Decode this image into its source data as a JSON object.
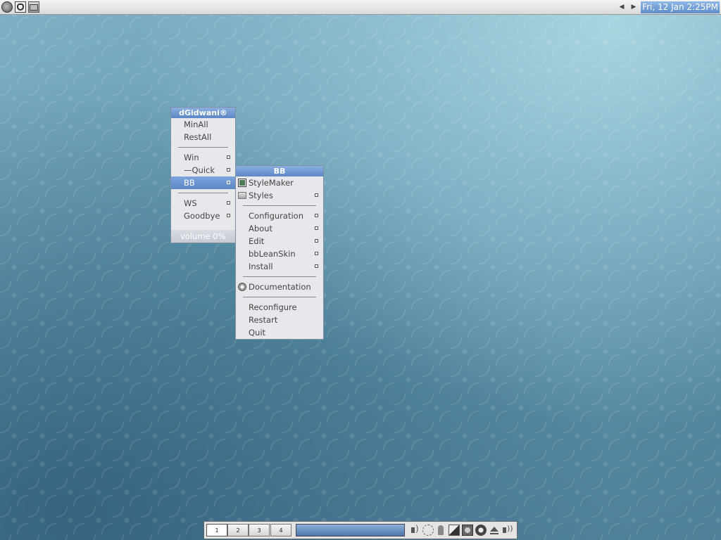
{
  "toolbar": {
    "clock": "Fri, 12 Jan 2:25PM",
    "icons": [
      "blackbox-icon",
      "style-icon",
      "folder-icon"
    ]
  },
  "main_menu": {
    "title": "dGidwani®",
    "items": [
      {
        "label": "MinAll"
      },
      {
        "label": "RestAll"
      },
      {
        "label": "Win"
      },
      {
        "label": "—Quick"
      },
      {
        "label": "BB"
      },
      {
        "label": "WS"
      },
      {
        "label": "Goodbye"
      }
    ],
    "volume": "volume 0%"
  },
  "bb_menu": {
    "title": "BB",
    "items": [
      {
        "label": "StyleMaker"
      },
      {
        "label": "Styles"
      },
      {
        "label": "Configuration"
      },
      {
        "label": "About"
      },
      {
        "label": "Edit"
      },
      {
        "label": "bbLeanSkin"
      },
      {
        "label": "Install"
      },
      {
        "label": "Documentation"
      },
      {
        "label": "Reconfigure"
      },
      {
        "label": "Restart"
      },
      {
        "label": "Quit"
      }
    ]
  },
  "taskbar": {
    "workspaces": [
      "1",
      "2",
      "3",
      "4"
    ],
    "current_workspace": "1",
    "accent": "#5f8ec8"
  }
}
